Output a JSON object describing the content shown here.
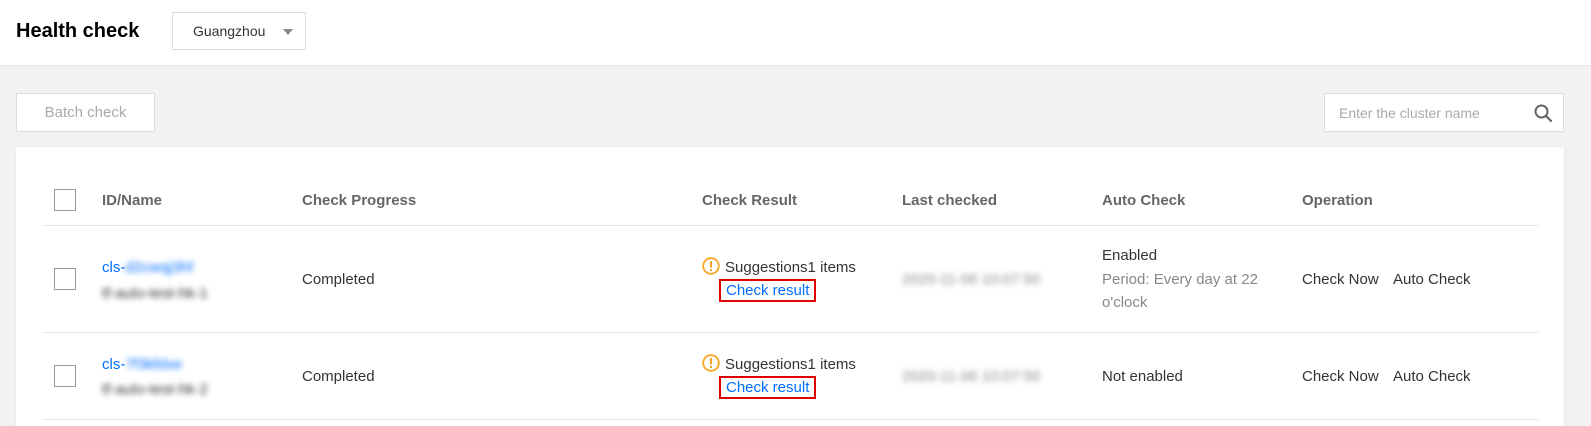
{
  "header": {
    "title": "Health check",
    "region": "Guangzhou"
  },
  "toolbar": {
    "batch_label": "Batch check",
    "search_placeholder": "Enter the cluster name"
  },
  "table": {
    "columns": [
      "ID/Name",
      "Check Progress",
      "Check Result",
      "Last checked",
      "Auto Check",
      "Operation"
    ],
    "rows": [
      {
        "id_prefix": "cls-",
        "id_rest": "d2cwqj3hf",
        "name": "tf-auto-test-hk-1",
        "progress": "Completed",
        "result": "Suggestions1 items",
        "result_link": "Check result",
        "last_checked": "2020-11-06 10:07:50",
        "auto_status": "Enabled",
        "auto_period": "Period: Every day at 22 o'clock",
        "op_check_now": "Check Now",
        "op_auto_check": "Auto Check"
      },
      {
        "id_prefix": "cls-",
        "id_rest": "7f3kfdxe",
        "name": "tf-auto-test-hk-2",
        "progress": "Completed",
        "result": "Suggestions1 items",
        "result_link": "Check result",
        "last_checked": "2020-11-06 10:07:50",
        "auto_status": "Not enabled",
        "op_check_now": "Check Now",
        "op_auto_check": "Auto Check"
      }
    ]
  },
  "colors": {
    "link": "#006eff",
    "warning": "#f5a623",
    "highlight_border": "#e00000"
  }
}
